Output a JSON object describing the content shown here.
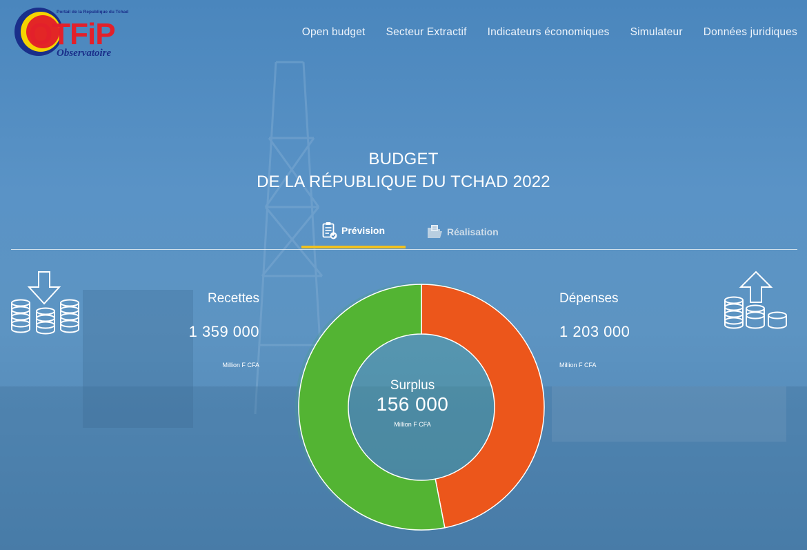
{
  "logo": {
    "tagline": "Portail de la Republique du Tchad",
    "wordmark": "OTFiP",
    "subtitle": "Observatoire"
  },
  "nav": {
    "items": [
      "Open budget",
      "Secteur Extractif",
      "Indicateurs économiques",
      "Simulateur",
      "Données juridiques"
    ]
  },
  "page": {
    "title_line1": "BUDGET",
    "title_line2": "DE LA RÉPUBLIQUE DU TCHAD 2022"
  },
  "tabs": [
    {
      "label": "Prévision",
      "icon": "clipboard-check-icon",
      "active": true
    },
    {
      "label": "Réalisation",
      "icon": "folder-document-icon",
      "active": false
    }
  ],
  "recettes": {
    "label": "Recettes",
    "value": "1 359 000",
    "unit": "Million F CFA",
    "icon": "coins-download-icon"
  },
  "depenses": {
    "label": "Dépenses",
    "value": "1 203 000",
    "unit": "Million F CFA",
    "icon": "coins-upload-icon"
  },
  "surplus": {
    "label": "Surplus",
    "value": "156 000",
    "unit": "Million F CFA"
  },
  "chart_data": {
    "type": "pie",
    "categories": [
      "Dépenses",
      "Recettes"
    ],
    "values": [
      1203000,
      1359000
    ],
    "colors": [
      "#ec561b",
      "#53b433"
    ]
  }
}
